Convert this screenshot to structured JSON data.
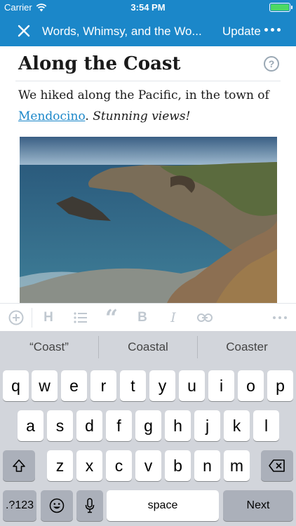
{
  "status_bar": {
    "carrier": "Carrier",
    "time": "3:54 PM"
  },
  "nav": {
    "title": "Words, Whimsy, and the Wo...",
    "update_label": "Update"
  },
  "post": {
    "title": "Along the Coast",
    "body_before": "We hiked along the Pacific, in the town of ",
    "link_text": "Mendocino",
    "body_after_link": ". ",
    "body_italic": "Stunning views!"
  },
  "format_toolbar": {
    "heading_label": "H",
    "bold_label": "B",
    "italic_label": "I"
  },
  "suggestions": [
    "“Coast”",
    "Coastal",
    "Coaster"
  ],
  "keyboard": {
    "row1": [
      "q",
      "w",
      "e",
      "r",
      "t",
      "y",
      "u",
      "i",
      "o",
      "p"
    ],
    "row2": [
      "a",
      "s",
      "d",
      "f",
      "g",
      "h",
      "j",
      "k",
      "l"
    ],
    "row3": [
      "z",
      "x",
      "c",
      "v",
      "b",
      "n",
      "m"
    ],
    "numbers_label": ".?123",
    "space_label": "space",
    "next_label": "Next"
  },
  "colors": {
    "accent": "#1b87c9",
    "keyboard_bg": "#d2d5db",
    "function_key": "#abb0ba"
  }
}
